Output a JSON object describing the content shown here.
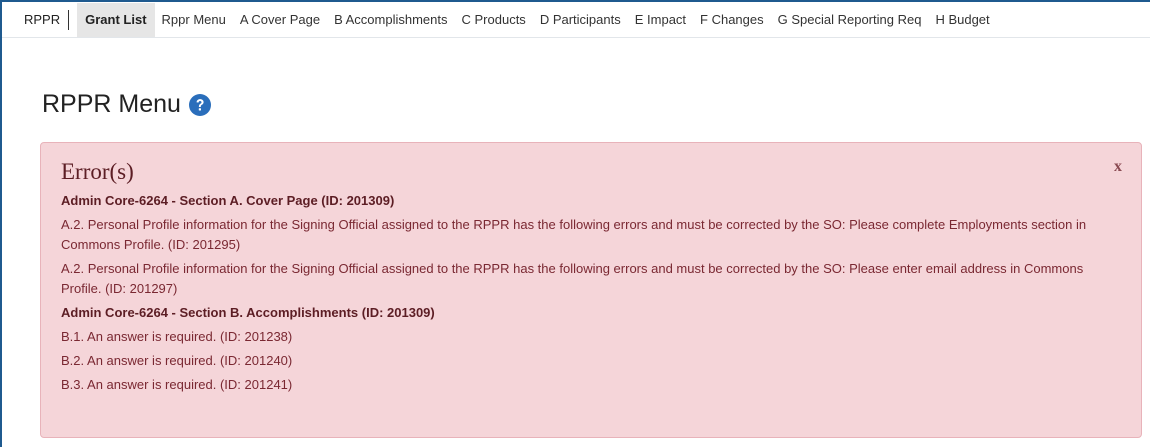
{
  "nav": {
    "brand": "RPPR",
    "items": [
      {
        "label": "Grant List",
        "active": true
      },
      {
        "label": "Rppr Menu"
      },
      {
        "label": "A Cover Page"
      },
      {
        "label": "B Accomplishments"
      },
      {
        "label": "C Products"
      },
      {
        "label": "D Participants"
      },
      {
        "label": "E Impact"
      },
      {
        "label": "F Changes"
      },
      {
        "label": "G Special Reporting Req"
      },
      {
        "label": "H Budget"
      }
    ]
  },
  "page": {
    "title": "RPPR Menu",
    "help_icon": "question-circle-icon"
  },
  "alert": {
    "title": "Error(s)",
    "close_label": "x",
    "messages": [
      {
        "type": "section",
        "text": "Admin Core-6264 - Section A. Cover Page (ID: 201309)"
      },
      {
        "type": "line",
        "text": "A.2. Personal Profile information for the Signing Official assigned to the RPPR has the following errors and must be corrected by the SO: Please complete Employments section in Commons Profile. (ID: 201295)"
      },
      {
        "type": "line",
        "text": "A.2. Personal Profile information for the Signing Official assigned to the RPPR has the following errors and must be corrected by the SO: Please enter email address in Commons Profile. (ID: 201297)"
      },
      {
        "type": "section",
        "text": "Admin Core-6264 - Section B. Accomplishments (ID: 201309)"
      },
      {
        "type": "line",
        "text": "B.1. An answer is required. (ID: 201238)"
      },
      {
        "type": "line",
        "text": "B.2. An answer is required. (ID: 201240)"
      },
      {
        "type": "line",
        "text": "B.3. An answer is required. (ID: 201241)"
      }
    ]
  },
  "colors": {
    "alert_bg": "#f5d5d9",
    "alert_text": "#7a2832",
    "help_icon": "#2a6ebb",
    "active_tab_bg": "#e6e6e6"
  }
}
